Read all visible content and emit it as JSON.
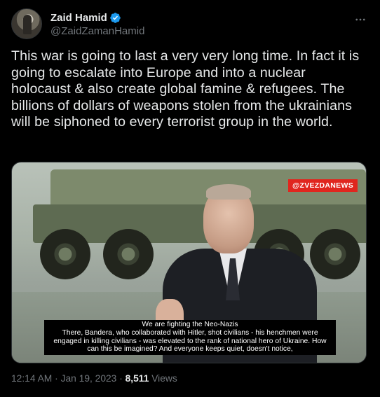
{
  "author": {
    "display_name": "Zaid Hamid",
    "handle": "@ZaidZamanHamid",
    "verified_badge_icon": "verified-badge-icon",
    "verified_color": "#1d9bf0"
  },
  "more_icon": "more-horizontal-icon",
  "tweet": {
    "text": "This war is going to last a very very long time. In fact it is going to escalate into Europe and into a nuclear holocaust & also create global famine & refugees. The billions of dollars of weapons stolen from the ukrainians will be siphoned to every terrorist group in the world."
  },
  "media": {
    "watermark": "@ZVEZDANEWS",
    "watermark_color": "#e0261e",
    "subtitle_line1": "We are fighting the Neo-Nazis",
    "subtitle_line2": "There, Bandera, who collaborated with Hitler, shot civilians - his henchmen were engaged in killing civilians - was elevated to the rank of national hero of Ukraine. How can this be imagined? And everyone keeps quiet, doesn't notice,"
  },
  "meta": {
    "time": "12:14 AM",
    "separator": " · ",
    "date": "Jan 19, 2023",
    "views_count": "8,511",
    "views_label": "Views"
  }
}
